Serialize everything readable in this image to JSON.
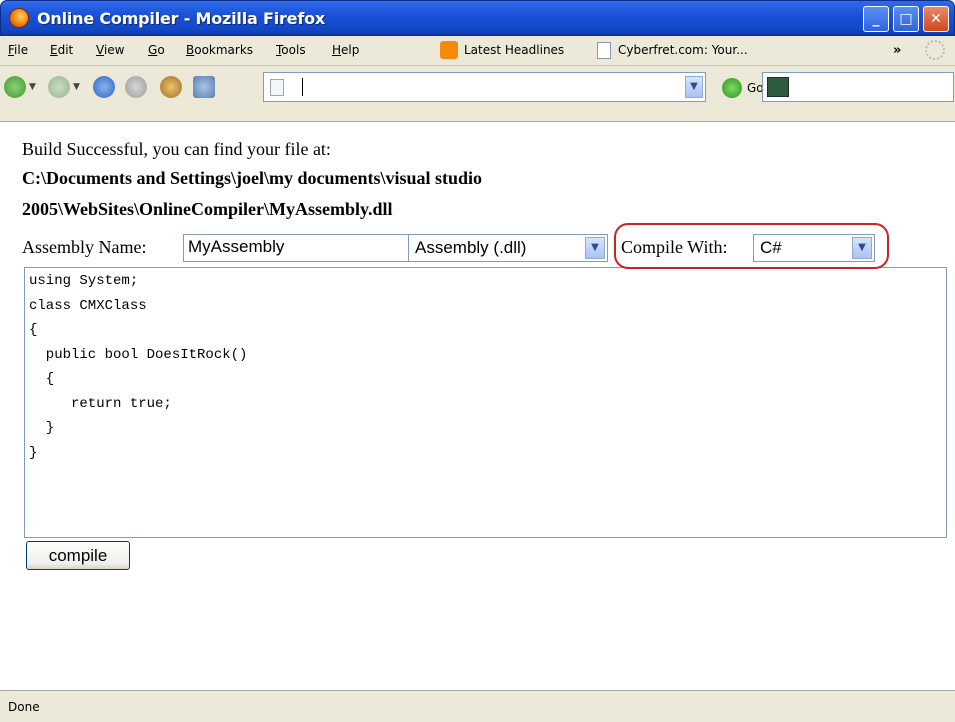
{
  "window": {
    "title": "Online Compiler - Mozilla Firefox"
  },
  "menu": {
    "items": [
      {
        "label": "File",
        "u": "F",
        "rest": "ile"
      },
      {
        "label": "Edit",
        "u": "E",
        "rest": "dit"
      },
      {
        "label": "View",
        "u": "V",
        "rest": "iew"
      },
      {
        "label": "Go",
        "u": "G",
        "rest": "o"
      },
      {
        "label": "Bookmarks",
        "u": "B",
        "rest": "ookmarks"
      },
      {
        "label": "Tools",
        "u": "T",
        "rest": "ools"
      },
      {
        "label": "Help",
        "u": "H",
        "rest": "elp"
      }
    ],
    "bookmark1": "Latest Headlines",
    "bookmark2": "Cyberfret.com: Your...",
    "overflow": "»"
  },
  "nav": {
    "url": "",
    "go_label": "Go",
    "drop": "▼"
  },
  "page": {
    "message": "Build Successful, you can find your file at:",
    "path_line1": "C:\\Documents and Settings\\joel\\my documents\\visual studio",
    "path_line2": "2005\\WebSites\\OnlineCompiler\\MyAssembly.dll",
    "assembly_label": "Assembly Name:",
    "assembly_name": "MyAssembly",
    "output_type": "Assembly (.dll)",
    "compile_with_label": "Compile With:",
    "language": "C#",
    "code": "using System;\nclass CMXClass\n{\n  public bool DoesItRock()\n  {\n     return true;\n  }\n}",
    "compile_button": "compile"
  },
  "status": {
    "text": "Done"
  },
  "colors": {
    "titlebar": "#1a52d8",
    "chrome": "#ece9d8",
    "highlight": "#cc2222"
  }
}
